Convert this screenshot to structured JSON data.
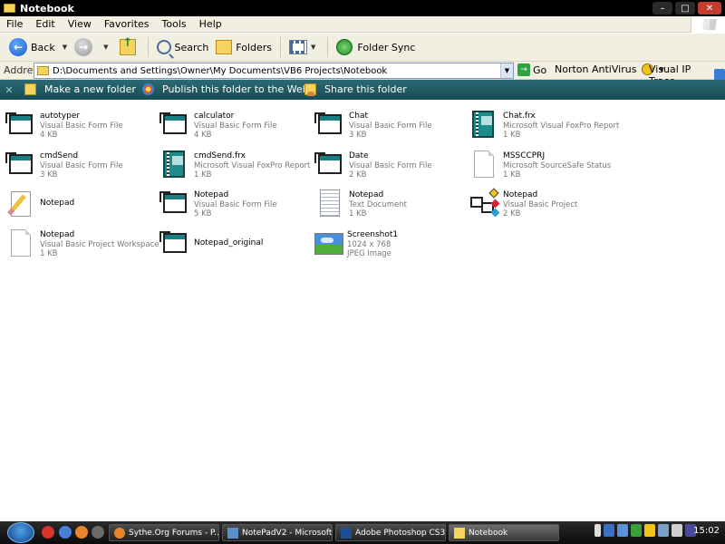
{
  "window": {
    "title": "Notebook"
  },
  "menu": [
    "File",
    "Edit",
    "View",
    "Favorites",
    "Tools",
    "Help"
  ],
  "toolbar": {
    "back_label": "Back",
    "search_label": "Search",
    "folders_label": "Folders",
    "sync_label": "Folder Sync"
  },
  "address": {
    "label": "Address",
    "path": "D:\\Documents and Settings\\Owner\\My Documents\\VB6 Projects\\Notebook",
    "go_label": "Go",
    "norton_label": "Norton AntiVirus",
    "vip_label": "Visual IP Trace"
  },
  "band": {
    "new_folder": "Make a new folder",
    "publish": "Publish this folder to the Web",
    "share": "Share this folder"
  },
  "files": [
    {
      "name": "autotyper",
      "type": "Visual Basic Form File",
      "size": "4 KB",
      "icon": "vbform-icon"
    },
    {
      "name": "calculator",
      "type": "Visual Basic Form File",
      "size": "4 KB",
      "icon": "vbform-icon"
    },
    {
      "name": "Chat",
      "type": "Visual Basic Form File",
      "size": "3 KB",
      "icon": "vbform-icon"
    },
    {
      "name": "Chat.frx",
      "type": "Microsoft Visual FoxPro Report",
      "size": "1 KB",
      "icon": "foxpro-report-icon"
    },
    {
      "name": "cmdSend",
      "type": "Visual Basic Form File",
      "size": "3 KB",
      "icon": "vbform-icon"
    },
    {
      "name": "cmdSend.frx",
      "type": "Microsoft Visual FoxPro Report",
      "size": "1 KB",
      "icon": "foxpro-report-icon"
    },
    {
      "name": "Date",
      "type": "Visual Basic Form File",
      "size": "2 KB",
      "icon": "vbform-icon"
    },
    {
      "name": "MSSCCPRJ",
      "type": "Microsoft SourceSafe Status",
      "size": "1 KB",
      "icon": "blank-document-icon"
    },
    {
      "name": "Notepad",
      "type": "",
      "size": "",
      "icon": "notepad-app-icon"
    },
    {
      "name": "Notepad",
      "type": "Visual Basic Form File",
      "size": "5 KB",
      "icon": "vbform-icon"
    },
    {
      "name": "Notepad",
      "type": "Text Document",
      "size": "1 KB",
      "icon": "text-document-icon"
    },
    {
      "name": "Notepad",
      "type": "Visual Basic Project",
      "size": "2 KB",
      "icon": "vbproject-icon"
    },
    {
      "name": "Notepad",
      "type": "Visual Basic Project Workspace",
      "size": "1 KB",
      "icon": "blank-document-icon"
    },
    {
      "name": "Notepad_original",
      "type": "",
      "size": "",
      "icon": "vbform-icon"
    },
    {
      "name": "Screenshot1",
      "type": "1024 x 768",
      "size": "JPEG Image",
      "icon": "jpeg-image-icon"
    }
  ],
  "taskbar": {
    "tasks": [
      {
        "label": "Sythe.Org Forums - P...",
        "icon": "firefox-icon"
      },
      {
        "label": "NotePadV2 - Microsoft...",
        "icon": "vb-ide-icon"
      },
      {
        "label": "Adobe Photoshop CS3...",
        "icon": "photoshop-icon"
      },
      {
        "label": "Notebook",
        "icon": "folder-icon"
      }
    ],
    "clock": "15:02"
  }
}
